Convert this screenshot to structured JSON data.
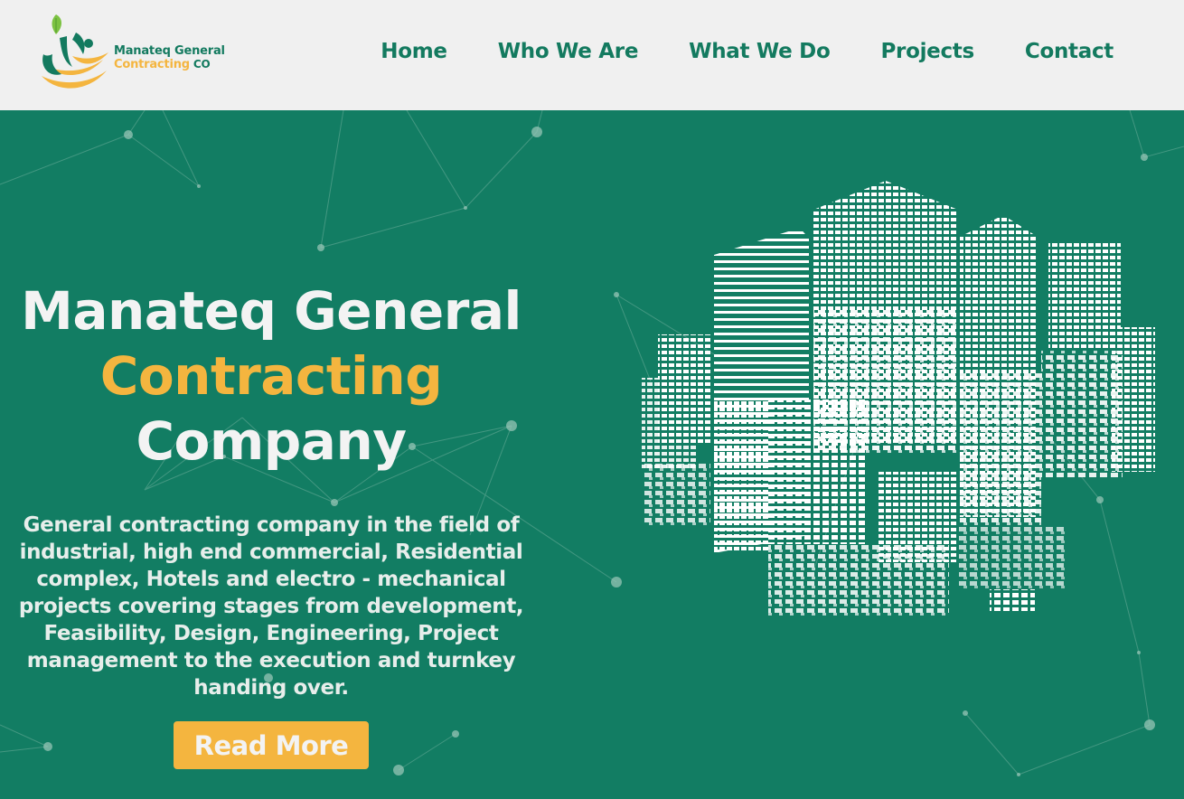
{
  "brand": {
    "name_line1": "Manateq General",
    "name_line2": "Contracting",
    "name_suffix": "CO",
    "logo_icon": "calligraphy-leaf-logo-icon"
  },
  "nav": {
    "items": [
      {
        "label": "Home"
      },
      {
        "label": "Who We Are"
      },
      {
        "label": "What We Do"
      },
      {
        "label": "Projects"
      },
      {
        "label": "Contact"
      }
    ]
  },
  "hero": {
    "title_line1": "Manateq General",
    "title_line2": "Contracting",
    "title_line3": "Company",
    "description": "General contracting company in the field of industrial, high end commercial, Residential complex, Hotels and electro - mechanical projects covering stages from development, Feasibility, Design, Engineering, Project management to the execution and turnkey handing over.",
    "cta_label": "Read More",
    "illustration_icon": "city-skyscrapers-illustration"
  },
  "colors": {
    "brand_green": "#127d63",
    "accent_yellow": "#f4b53f",
    "header_bg": "#f0f0f0",
    "text_light": "#f3f3f3"
  }
}
